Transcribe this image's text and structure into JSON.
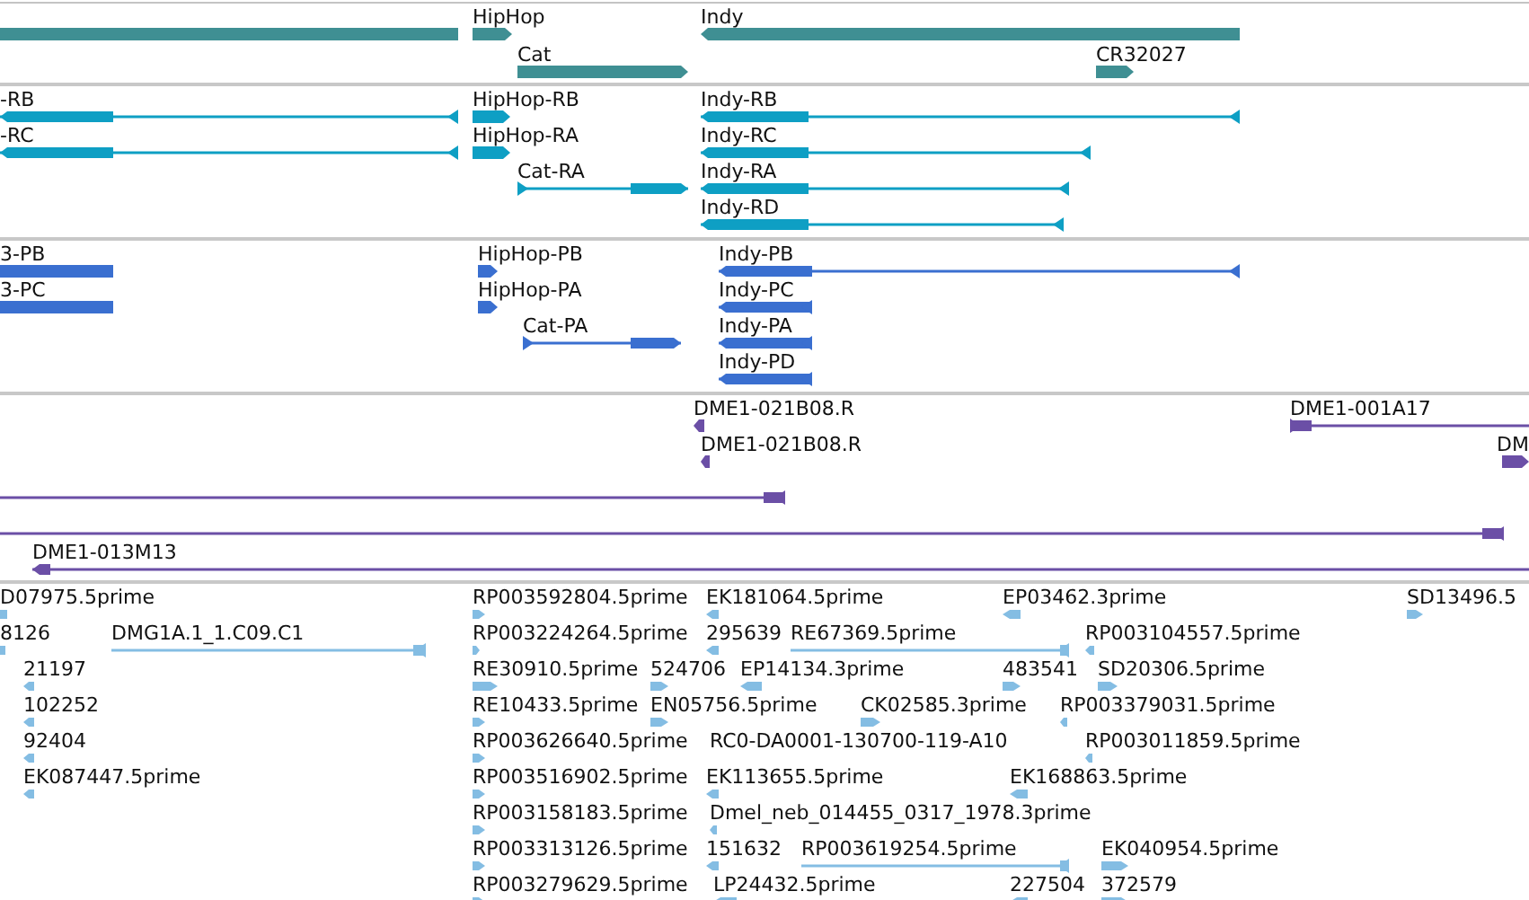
{
  "tracks": [
    {
      "color": "#3f8f93",
      "features": [
        {
          "kind": "plain"
        },
        {
          "label": "HipHop",
          "kind": "forward"
        },
        {
          "label": "Indy",
          "kind": "reverse"
        },
        {
          "label": "Cat",
          "kind": "forward"
        },
        {
          "label": "CR32027",
          "kind": "forward"
        }
      ]
    },
    {
      "color": "#0e9fc4",
      "features": [
        {
          "label": "-RB",
          "kind": "reverse"
        },
        {
          "label": "-RC",
          "kind": "reverse"
        },
        {
          "label": "HipHop-RB",
          "kind": "forward"
        },
        {
          "label": "HipHop-RA",
          "kind": "forward"
        },
        {
          "label": "Cat-RA",
          "kind": "forward"
        },
        {
          "label": "Indy-RB",
          "kind": "reverse"
        },
        {
          "label": "Indy-RC",
          "kind": "reverse"
        },
        {
          "label": "Indy-RA",
          "kind": "reverse"
        },
        {
          "label": "Indy-RD",
          "kind": "reverse"
        }
      ]
    },
    {
      "color": "#3a6fd0",
      "features": [
        {
          "label": "3-PB",
          "kind": "plain"
        },
        {
          "label": "3-PC",
          "kind": "plain"
        },
        {
          "label": "HipHop-PB",
          "kind": "forward"
        },
        {
          "label": "HipHop-PA",
          "kind": "forward"
        },
        {
          "label": "Cat-PA",
          "kind": "forward"
        },
        {
          "label": "Indy-PB",
          "kind": "reverse"
        },
        {
          "label": "Indy-PC",
          "kind": "reverse"
        },
        {
          "label": "Indy-PA",
          "kind": "reverse"
        },
        {
          "label": "Indy-PD",
          "kind": "reverse"
        }
      ]
    },
    {
      "color": "#6b4fa6",
      "features": [
        {
          "label": "DME1-021B08.R",
          "kind": "reverse"
        },
        {
          "label": "DME1-021B08.R",
          "kind": "reverse"
        },
        {
          "label": "DME1-001A17",
          "kind": "forward"
        },
        {
          "label": "DM",
          "kind": "forward"
        },
        {
          "kind": "reverse"
        },
        {
          "kind": "reverse"
        },
        {
          "label": "DME1-013M13",
          "kind": "reverse"
        }
      ]
    },
    {
      "color": "#84bde3",
      "features": [
        {
          "label": "D07975.5prime",
          "kind": "plain"
        },
        {
          "label": "RP003592804.5prime",
          "kind": "forward"
        },
        {
          "label": "EK181064.5prime",
          "kind": "reverse"
        },
        {
          "label": "EP03462.3prime",
          "kind": "reverse"
        },
        {
          "label": "SD13496.5",
          "kind": "forward"
        },
        {
          "label": "8126",
          "kind": "plain"
        },
        {
          "label": "DMG1A.1_1.C09.C1",
          "kind": "reverse"
        },
        {
          "label": "RP003224264.5prime",
          "kind": "forward"
        },
        {
          "label": "295639",
          "kind": "reverse"
        },
        {
          "label": "RE67369.5prime",
          "kind": "reverse"
        },
        {
          "label": "RP003104557.5prime",
          "kind": "reverse"
        },
        {
          "label": "21197",
          "kind": "reverse"
        },
        {
          "label": "RE30910.5prime",
          "kind": "forward"
        },
        {
          "label": "524706",
          "kind": "forward"
        },
        {
          "label": "EP14134.3prime",
          "kind": "reverse"
        },
        {
          "label": "483541",
          "kind": "forward"
        },
        {
          "label": "SD20306.5prime",
          "kind": "forward"
        },
        {
          "label": "102252",
          "kind": "reverse"
        },
        {
          "label": "RE10433.5prime",
          "kind": "forward"
        },
        {
          "label": "EN05756.5prime",
          "kind": "forward"
        },
        {
          "label": "CK02585.3prime",
          "kind": "forward"
        },
        {
          "label": "RP003379031.5prime",
          "kind": "reverse"
        },
        {
          "label": "92404",
          "kind": "reverse"
        },
        {
          "label": "RP003626640.5prime",
          "kind": "forward"
        },
        {
          "label": "RC0-DA0001-130700-119-A10"
        },
        {
          "label": "RP003011859.5prime",
          "kind": "reverse"
        },
        {
          "label": "EK087447.5prime",
          "kind": "reverse"
        },
        {
          "label": "RP003516902.5prime",
          "kind": "forward"
        },
        {
          "label": "EK113655.5prime",
          "kind": "reverse"
        },
        {
          "label": "EK168863.5prime",
          "kind": "reverse"
        },
        {
          "label": "RP003158183.5prime",
          "kind": "forward"
        },
        {
          "label": "Dmel_neb_014455_0317_1978.3prime",
          "kind": "reverse"
        },
        {
          "label": "RP003313126.5prime",
          "kind": "forward"
        },
        {
          "label": "151632",
          "kind": "reverse"
        },
        {
          "label": "RP003619254.5prime",
          "kind": "reverse"
        },
        {
          "label": "EK040954.5prime",
          "kind": "forward"
        },
        {
          "label": "RP003279629.5prime",
          "kind": "forward"
        },
        {
          "label": "LP24432.5prime",
          "kind": "reverse"
        },
        {
          "label": "227504",
          "kind": "reverse"
        },
        {
          "label": "372579",
          "kind": "forward"
        }
      ]
    }
  ]
}
